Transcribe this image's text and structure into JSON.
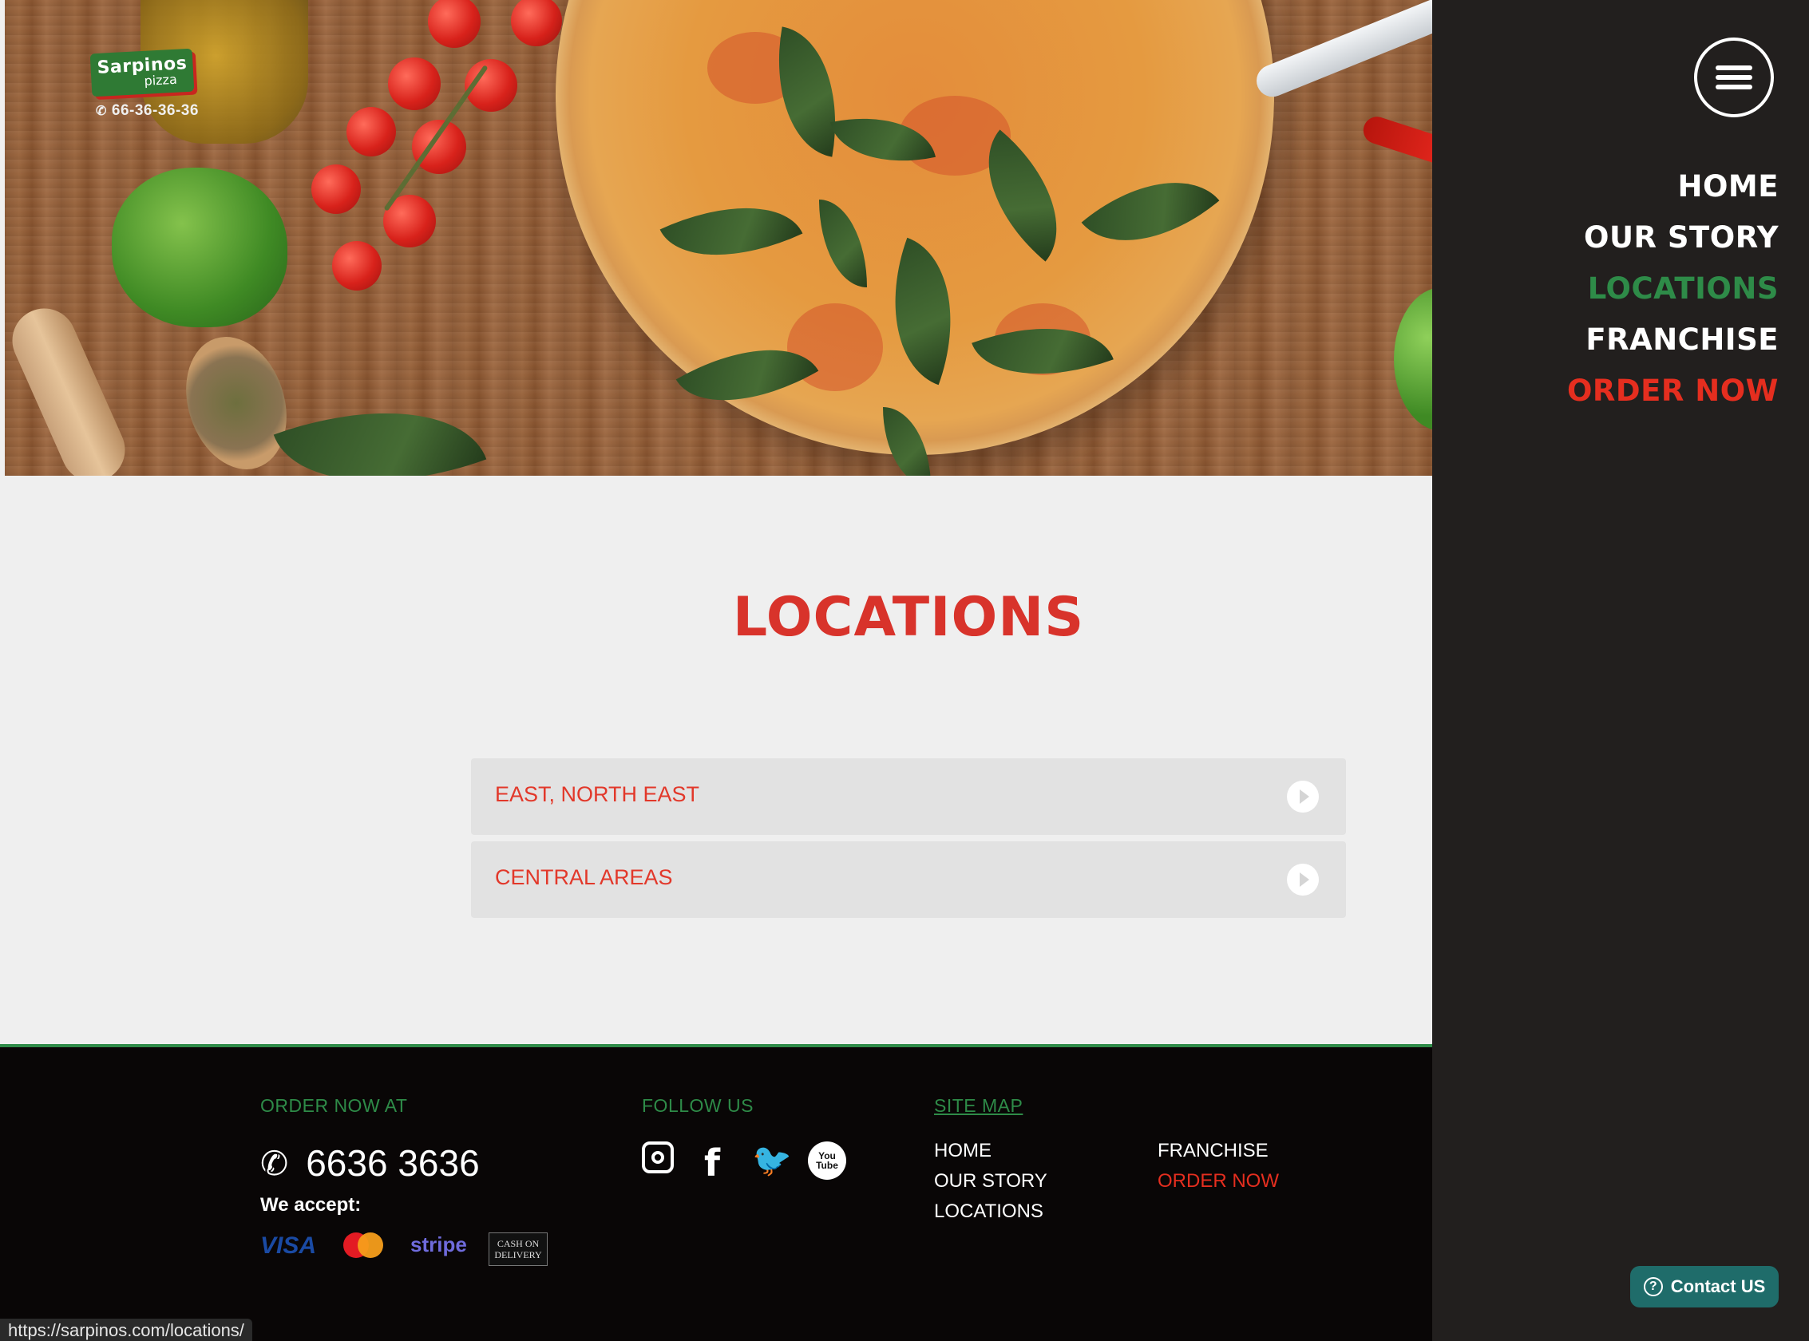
{
  "brand": {
    "logo_name": "Sarpinos",
    "logo_sub": "pizza",
    "header_phone": "66-36-36-36"
  },
  "sidebar": {
    "menu_icon": "hamburger-menu-icon",
    "items": [
      {
        "label": "HOME"
      },
      {
        "label": "OUR STORY"
      },
      {
        "label": "LOCATIONS"
      },
      {
        "label": "FRANCHISE"
      },
      {
        "label": "ORDER NOW"
      }
    ],
    "contact_label": "Contact US"
  },
  "main": {
    "title": "LOCATIONS",
    "accordion": [
      {
        "label": "EAST, NORTH EAST"
      },
      {
        "label": "CENTRAL AREAS"
      }
    ]
  },
  "footer": {
    "order_heading": "ORDER NOW AT",
    "phone": "6636 3636",
    "accept_label": "We accept:",
    "payments": {
      "visa": "VISA",
      "mastercard": "MasterCard",
      "stripe": "stripe",
      "cod_line1": "CASH ON",
      "cod_line2": "DELIVERY"
    },
    "follow_heading": "FOLLOW US",
    "social_icons": [
      "instagram-icon",
      "facebook-icon",
      "twitter-icon",
      "youtube-icon"
    ],
    "youtube_you": "You",
    "youtube_tube": "Tube",
    "sitemap_heading": "SITE MAP",
    "sitemap": {
      "col1": [
        "HOME",
        "OUR STORY",
        "LOCATIONS"
      ],
      "col2": [
        "FRANCHISE",
        "ORDER NOW"
      ]
    }
  },
  "status_url": "https://sarpinos.com/locations/",
  "colors": {
    "accent_red": "#d8332b",
    "accent_green": "#2e8b48",
    "sidebar_bg": "#221f1e",
    "footer_bg": "#090606",
    "contact_bg": "#1f6c6a"
  }
}
